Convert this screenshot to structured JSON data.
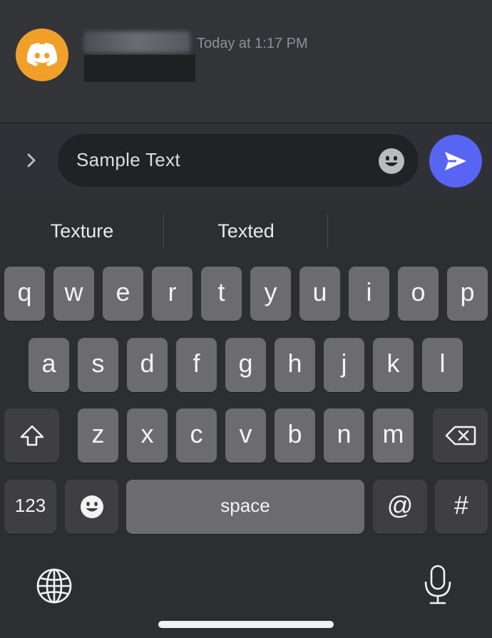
{
  "message": {
    "timestamp": "Today at 1:17 PM"
  },
  "composer": {
    "input_value": "Sample Text"
  },
  "keyboard": {
    "suggestions": [
      "Texture",
      "Texted",
      ""
    ],
    "row1": [
      "q",
      "w",
      "e",
      "r",
      "t",
      "y",
      "u",
      "i",
      "o",
      "p"
    ],
    "row2": [
      "a",
      "s",
      "d",
      "f",
      "g",
      "h",
      "j",
      "k",
      "l"
    ],
    "row3": [
      "z",
      "x",
      "c",
      "v",
      "b",
      "n",
      "m"
    ],
    "numbers_key": "123",
    "space_key": "space",
    "at_key": "@",
    "hash_key": "#"
  },
  "colors": {
    "avatar": "#f0a02a",
    "send_button": "#5865f2",
    "key": "#6c6c6f",
    "key_dark": "#3f3f41"
  }
}
